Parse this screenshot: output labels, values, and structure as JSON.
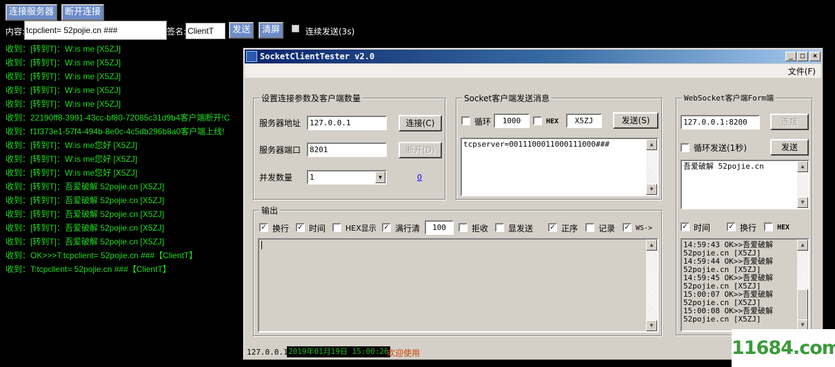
{
  "web": {
    "connect_button": "连接服务器",
    "disconnect_button": "断开连接",
    "content_label": "内容:",
    "content_value": "tcpclient= 52pojie.cn ###",
    "sign_label": "签名:",
    "sign_value": "ClientT",
    "send_button": "发送",
    "clear_button": "清屏",
    "continuous_label": "连续发送(3s)",
    "log_lines": [
      "收到：[转到T]：W:is me [X5ZJ]",
      "收到：[转到T]：W:is me [X5ZJ]",
      "收到：[转到T]：W:is me [X5ZJ]",
      "收到：[转到T]：W:is me [X5ZJ]",
      "收到：[转到T]：W:is me [X5ZJ]",
      "收到：22190ff8-3991-43cc-bf80-72085c31d9b4客户端断开!C",
      "收到：f1f373e1-57f4-494b-8e0c-4c5db296b8a0客户端上线!",
      "收到：[转到T]：W:is me您好 [X5ZJ]",
      "收到：[转到T]：W:is me您好 [X5ZJ]",
      "收到：[转到T]：W:is me您好 [X5ZJ]",
      "收到：[转到T]：吾爱破解 52pojie.cn [X5ZJ]",
      "收到：[转到T]：吾爱破解 52pojie.cn [X5ZJ]",
      "收到：[转到T]：吾爱破解 52pojie.cn [X5ZJ]",
      "收到：[转到T]：吾爱破解 52pojie.cn [X5ZJ]",
      "收到：[转到T]：吾爱破解 52pojie.cn [X5ZJ]",
      "收到：OK>>>T:tcpclient= 52pojie.cn ###【ClientT】",
      "收到：T:tcpclient= 52pojie.cn ###【ClientT】"
    ]
  },
  "window": {
    "title": "SocketClientTester v2.0",
    "menu_file": "文件(F)",
    "connection_group": {
      "title": "设置连接参数及客户端数量",
      "address_label": "服务器地址",
      "address_value": "127.0.0.1",
      "port_label": "服务器端口",
      "port_value": "8201",
      "concurrency_label": "并发数量",
      "concurrency_value": "1",
      "connect_button": "连接(C)",
      "disconnect_button": "断开(D)",
      "count_link": "0"
    },
    "socket_send_group": {
      "title": "Socket客户端发送消息",
      "loop_label": "循环",
      "loop_interval": "1000",
      "hex_label": "HEX",
      "tag_value": "X5ZJ",
      "send_button": "发送(S)",
      "message": "tcpserver=0011100011000111000###"
    },
    "websocket_group": {
      "title": "WebSocket客户端Form端",
      "url_value": "127.0.0.1:8200",
      "connect_button": "连接",
      "loop_send_label": "循环发送(1秒)",
      "send_button": "发送",
      "message": "吾爱破解 52pojie.cn",
      "time_label": "时间",
      "wrap_label": "换行",
      "hex_label": "HEX",
      "log": "14:59:43 OK>>吾爱破解\n52pojie.cn [X5ZJ]\n14:59:44 OK>>吾爱破解\n52pojie.cn [X5ZJ]\n14:59:45 OK>>吾爱破解\n52pojie.cn [X5ZJ]\n15:00:07 OK>>吾爱破解\n52pojie.cn [X5ZJ]\n15:00:08 OK>>吾爱破解\n52pojie.cn [X5ZJ]"
    },
    "output_group": {
      "title": "输出",
      "wrap_label": "换行",
      "time_label": "时间",
      "hex_display_label": "HEX显示",
      "full_clear_label": "满行清",
      "full_clear_value": "100",
      "reject_label": "拒收",
      "show_send_label": "显发送",
      "order_label": "正序",
      "record_label": "记录",
      "ws_label": "WS->"
    },
    "status": {
      "ip": "127.0.0.1",
      "datetime": "2019年01月19日 15:00:26",
      "welcome": "欢迎使用"
    }
  },
  "watermark": "11684.com",
  "colors": {
    "log_green": "#22dd22",
    "web_button": "#6b8cc8",
    "window_face": "#d4d0c8",
    "title_start": "#0a246a",
    "status_welcome": "#cc4400"
  }
}
